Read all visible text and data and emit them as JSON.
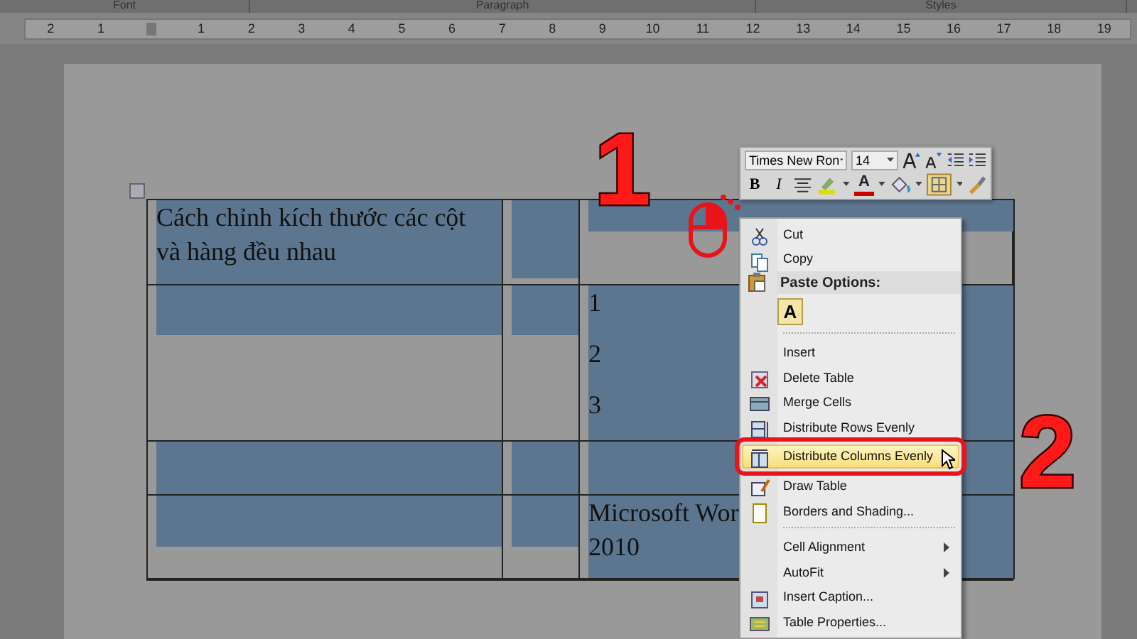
{
  "ribbon_groups": [
    "Font",
    "Paragraph",
    "Styles"
  ],
  "ruler": {
    "left_labels": [
      "2",
      "1"
    ],
    "right_labels": [
      "1",
      "2",
      "3",
      "4",
      "5",
      "6",
      "7",
      "8",
      "9",
      "10",
      "11",
      "12",
      "13",
      "14",
      "15",
      "16",
      "17",
      "18",
      "19"
    ]
  },
  "table": {
    "rows": [
      {
        "cells": [
          {
            "paragraphs": [
              "Cách chỉnh kích thước các cột và hàng đều nhau"
            ]
          },
          {},
          {}
        ]
      },
      {
        "cells": [
          {},
          {},
          {
            "paragraphs": [
              "1",
              "2",
              "3"
            ]
          }
        ]
      },
      {
        "cells": [
          {},
          {},
          {}
        ]
      },
      {
        "cells": [
          {},
          {},
          {
            "paragraphs": [
              "Microsoft Wor",
              "2010"
            ]
          }
        ]
      }
    ]
  },
  "mini_toolbar": {
    "font": "Times New Ron",
    "size": "14",
    "bold": "B",
    "italic": "I",
    "font_color": "A"
  },
  "context_menu": {
    "items": [
      {
        "kind": "item",
        "label": "Cut",
        "selected": false
      },
      {
        "kind": "item",
        "label": "Copy",
        "selected": false
      },
      {
        "kind": "header",
        "label": "Paste Options:"
      },
      {
        "kind": "paste",
        "label": "A"
      },
      {
        "kind": "separator"
      },
      {
        "kind": "item",
        "label": "Insert",
        "selected": false
      },
      {
        "kind": "item",
        "label": "Delete Table",
        "selected": false
      },
      {
        "kind": "item",
        "label": "Merge Cells",
        "selected": false
      },
      {
        "kind": "item",
        "label": "Distribute Rows Evenly",
        "selected": false
      },
      {
        "kind": "item",
        "label": "Distribute Columns Evenly",
        "selected": true
      },
      {
        "kind": "item",
        "label": "Draw Table",
        "selected": false
      },
      {
        "kind": "item",
        "label": "Borders and Shading...",
        "selected": false
      },
      {
        "kind": "separator"
      },
      {
        "kind": "item",
        "label": "Cell Alignment",
        "submenu": true,
        "selected": false
      },
      {
        "kind": "item",
        "label": "AutoFit",
        "submenu": true,
        "selected": false
      },
      {
        "kind": "item",
        "label": "Insert Caption...",
        "selected": false
      },
      {
        "kind": "item",
        "label": "Table Properties...",
        "selected": false
      }
    ]
  },
  "annotations": [
    "1",
    "2"
  ]
}
